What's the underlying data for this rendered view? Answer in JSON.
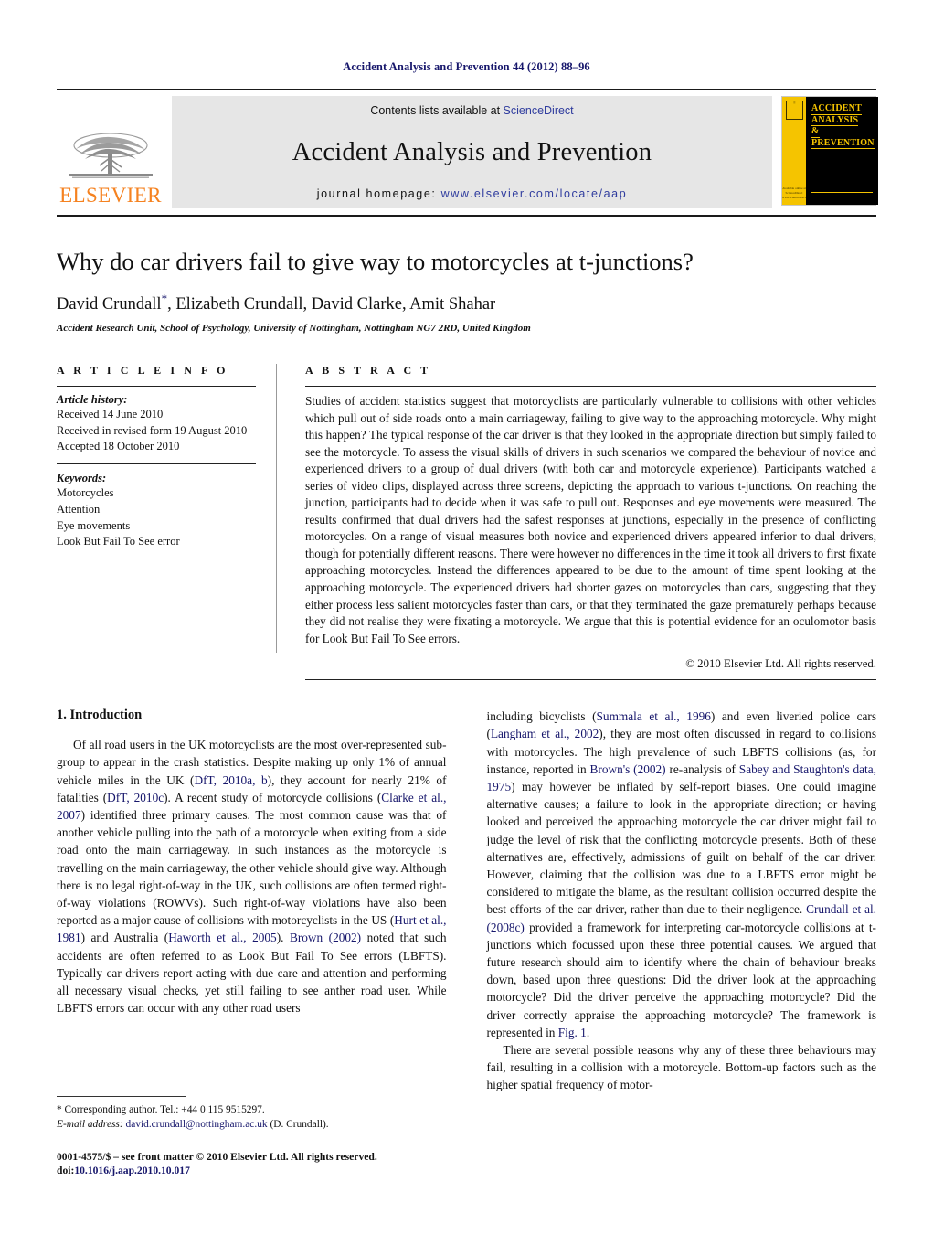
{
  "running_head": "Accident Analysis and Prevention 44 (2012) 88–96",
  "masthead": {
    "publisher_wordmark": "ELSEVIER",
    "contents_prefix": "Contents lists available at ",
    "contents_link": "ScienceDirect",
    "journal_name": "Accident Analysis and Prevention",
    "homepage_prefix": "journal homepage: ",
    "homepage_url": "www.elsevier.com/locate/aap",
    "cover": {
      "line1": "ACCIDENT",
      "line2": "ANALYSIS",
      "line3": "&",
      "line4": "PREVENTION",
      "foot1": "Available online at",
      "foot2": "ScienceDirect",
      "foot3": "www.sciencedirect.com",
      "yellow": "#f5c400",
      "black": "#000000"
    }
  },
  "title": "Why do car drivers fail to give way to motorcycles at t-junctions?",
  "authors": "David Crundall, Elizabeth Crundall, David Clarke, Amit Shahar",
  "author_marker": "*",
  "affiliation": "Accident Research Unit, School of Psychology, University of Nottingham, Nottingham NG7 2RD, United Kingdom",
  "article_info": {
    "heading": "A R T I C L E   I N F O",
    "history_label": "Article history:",
    "history": [
      "Received 14 June 2010",
      "Received in revised form 19 August 2010",
      "Accepted 18 October 2010"
    ],
    "keywords_label": "Keywords:",
    "keywords": [
      "Motorcycles",
      "Attention",
      "Eye movements",
      "Look But Fail To See error"
    ]
  },
  "abstract": {
    "heading": "A B S T R A C T",
    "text": "Studies of accident statistics suggest that motorcyclists are particularly vulnerable to collisions with other vehicles which pull out of side roads onto a main carriageway, failing to give way to the approaching motorcycle. Why might this happen? The typical response of the car driver is that they looked in the appropriate direction but simply failed to see the motorcycle. To assess the visual skills of drivers in such scenarios we compared the behaviour of novice and experienced drivers to a group of dual drivers (with both car and motorcycle experience). Participants watched a series of video clips, displayed across three screens, depicting the approach to various t-junctions. On reaching the junction, participants had to decide when it was safe to pull out. Responses and eye movements were measured. The results confirmed that dual drivers had the safest responses at junctions, especially in the presence of conflicting motorcycles. On a range of visual measures both novice and experienced drivers appeared inferior to dual drivers, though for potentially different reasons. There were however no differences in the time it took all drivers to first fixate approaching motorcycles. Instead the differences appeared to be due to the amount of time spent looking at the approaching motorcycle. The experienced drivers had shorter gazes on motorcycles than cars, suggesting that they either process less salient motorcycles faster than cars, or that they terminated the gaze prematurely perhaps because they did not realise they were fixating a motorcycle. We argue that this is potential evidence for an oculomotor basis for Look But Fail To See errors.",
    "copyright": "© 2010 Elsevier Ltd. All rights reserved."
  },
  "body": {
    "section_title": "1.  Introduction",
    "left_paragraph_1_parts": {
      "t1": "Of all road users in the UK motorcyclists are the most over-represented sub-group to appear in the crash statistics. Despite making up only 1% of annual vehicle miles in the UK (",
      "c1": "DfT, 2010a, b",
      "t2": "), they account for nearly 21% of fatalities (",
      "c2": "DfT, 2010c",
      "t3": "). A recent study of motorcycle collisions (",
      "c3": "Clarke et al., 2007",
      "t4": ") identified three primary causes. The most common cause was that of another vehicle pulling into the path of a motorcycle when exiting from a side road onto the main carriageway. In such instances as the motorcycle is travelling on the main carriageway, the other vehicle should give way. Although there is no legal right-of-way in the UK, such collisions are often termed right-of-way violations (ROWVs). Such right-of-way violations have also been reported as a major cause of collisions with motorcyclists in the US (",
      "c4": "Hurt et al., 1981",
      "t5": ") and Australia (",
      "c5": "Haworth et al., 2005",
      "t6": "). ",
      "c6": "Brown (2002)",
      "t7": " noted that such accidents are often referred to as Look But Fail To See errors (LBFTS). Typically car drivers report acting with due care and attention and performing all necessary visual checks, yet still failing to see anther road user. While LBFTS errors can occur with any other road users"
    },
    "right_paragraph_1_parts": {
      "t1": "including bicyclists (",
      "c1": "Summala et al., 1996",
      "t2": ") and even liveried police cars (",
      "c2": "Langham et al., 2002",
      "t3": "), they are most often discussed in regard to collisions with motorcycles. The high prevalence of such LBFTS collisions (as, for instance, reported in ",
      "c3": "Brown's (2002)",
      "t4": " re-analysis of ",
      "c4": "Sabey and Staughton's data, 1975",
      "t5": ") may however be inflated by self-report biases. One could imagine alternative causes; a failure to look in the appropriate direction; or having looked and perceived the approaching motorcycle the car driver might fail to judge the level of risk that the conflicting motorcycle presents. Both of these alternatives are, effectively, admissions of guilt on behalf of the car driver. However, claiming that the collision was due to a LBFTS error might be considered to mitigate the blame, as the resultant collision occurred despite the best efforts of the car driver, rather than due to their negligence. ",
      "c5": "Crundall et al. (2008c)",
      "t6": " provided a framework for interpreting car-motorcycle collisions at t-junctions which focussed upon these three potential causes. We argued that future research should aim to identify where the chain of behaviour breaks down, based upon three questions: Did the driver look at the approaching motorcycle? Did the driver perceive the approaching motorcycle? Did the driver correctly appraise the approaching motorcycle? The framework is represented in ",
      "c6": "Fig. 1",
      "t7": "."
    },
    "right_paragraph_2": "There are several possible reasons why any of these three behaviours may fail, resulting in a collision with a motorcycle. Bottom-up factors such as the higher spatial frequency of motor-"
  },
  "footnotes": {
    "corresponding": "* Corresponding author. Tel.: +44 0 115 9515297.",
    "email_label": "E-mail address:",
    "email": "david.crundall@nottingham.ac.uk",
    "email_suffix": " (D. Crundall).",
    "issn_line": "0001-4575/$ – see front matter © 2010 Elsevier Ltd. All rights reserved.",
    "doi_prefix": "doi:",
    "doi": "10.1016/j.aap.2010.10.017"
  },
  "colors": {
    "link": "#16166b",
    "elsevier_orange": "#f58220",
    "banner_grey": "#e6e6e6"
  }
}
